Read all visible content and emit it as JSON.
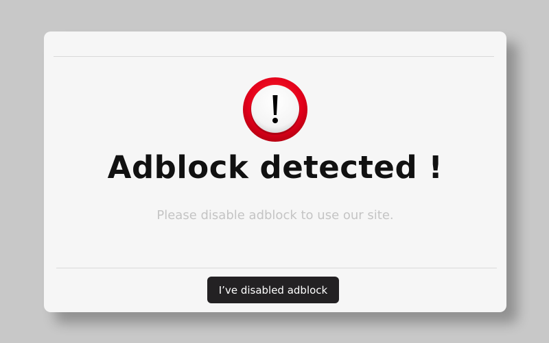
{
  "modal": {
    "icon": "exclamation-alert-icon",
    "title": "Adblock detected !",
    "message": "Please disable adblock to use our site.",
    "confirm_button_label": "I’ve disabled adblock"
  },
  "colors": {
    "backdrop": "#c8c8c8",
    "modal_background": "#f6f6f6",
    "alert_red": "#e3001b",
    "button_background": "#232123",
    "button_text": "#ffffff",
    "subtitle_text": "#c4c4c4"
  }
}
